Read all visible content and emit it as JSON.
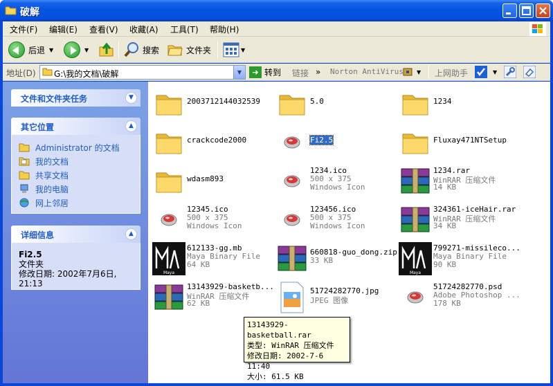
{
  "window": {
    "title": "破解"
  },
  "menu": [
    "文件(F)",
    "编辑(E)",
    "查看(V)",
    "收藏(A)",
    "工具(T)",
    "帮助(H)"
  ],
  "toolbar": {
    "back": "后退",
    "search": "搜索",
    "folders": "文件夹"
  },
  "address": {
    "label": "地址(D)",
    "path": "G:\\我的文档\\破解",
    "go": "转到",
    "links": "链接",
    "norton": "Norton AntiVirus",
    "assistant": "上网助手"
  },
  "sidebar": {
    "tasks_title": "文件和文件夹任务",
    "places_title": "其它位置",
    "places": [
      "Administrator 的文档",
      "我的文档",
      "共享文档",
      "我的电脑",
      "网上邻居"
    ],
    "details_title": "详细信息",
    "details_name": "Fi2.5",
    "details_type": "文件夹",
    "details_modified": "修改日期: 2002年7月6日,",
    "details_time": "21:13"
  },
  "files": [
    {
      "name": "2003712144032539",
      "lines": [],
      "kind": "folder"
    },
    {
      "name": "5.0",
      "lines": [],
      "kind": "folder"
    },
    {
      "name": "1234",
      "lines": [],
      "kind": "folder"
    },
    {
      "name": "crackcode2000",
      "lines": [],
      "kind": "folder"
    },
    {
      "name": "Fi2.5",
      "lines": [],
      "kind": "ico"
    },
    {
      "name": "Fluxay471NTSetup",
      "lines": [],
      "kind": "folder"
    },
    {
      "name": "wdasm893",
      "lines": [],
      "kind": "folder"
    },
    {
      "name": "1234.ico",
      "lines": [
        "500 x 375",
        "Windows Icon"
      ],
      "kind": "ico"
    },
    {
      "name": "1234.rar",
      "lines": [
        "WinRAR 压缩文件",
        "14 KB"
      ],
      "kind": "rar"
    },
    {
      "name": "12345.ico",
      "lines": [
        "500 x 375",
        "Windows Icon"
      ],
      "kind": "ico"
    },
    {
      "name": "123456.ico",
      "lines": [
        "500 x 375",
        "Windows Icon"
      ],
      "kind": "ico"
    },
    {
      "name": "324361-iceHair.rar",
      "lines": [
        "WinRAR 压缩文件",
        "34 KB"
      ],
      "kind": "rar"
    },
    {
      "name": "612133-gg.mb",
      "lines": [
        "Maya Binary File",
        "64 KB"
      ],
      "kind": "maya"
    },
    {
      "name": "660818-guo_dong.zip",
      "lines": [
        "33 KB"
      ],
      "kind": "rar"
    },
    {
      "name": "799271-missileco...",
      "lines": [
        "Maya Binary File",
        "90 KB"
      ],
      "kind": "maya"
    },
    {
      "name": "13143929-basketb...",
      "lines": [
        "WinRAR 压缩文件",
        "62 KB"
      ],
      "kind": "rar"
    },
    {
      "name": "51724282770.jpg",
      "lines": [
        "JPEG 图像"
      ],
      "kind": "jpg"
    },
    {
      "name": "51724282770.psd",
      "lines": [
        "Adobe Photoshop ...",
        "178 KB"
      ],
      "kind": "ico"
    }
  ],
  "tooltip": {
    "line1": "13143929-basketball.rar",
    "line2": "类型: WinRAR 压缩文件",
    "line3": "修改日期: 2002-7-6 11:40",
    "line4": "大小: 61.5 KB"
  }
}
